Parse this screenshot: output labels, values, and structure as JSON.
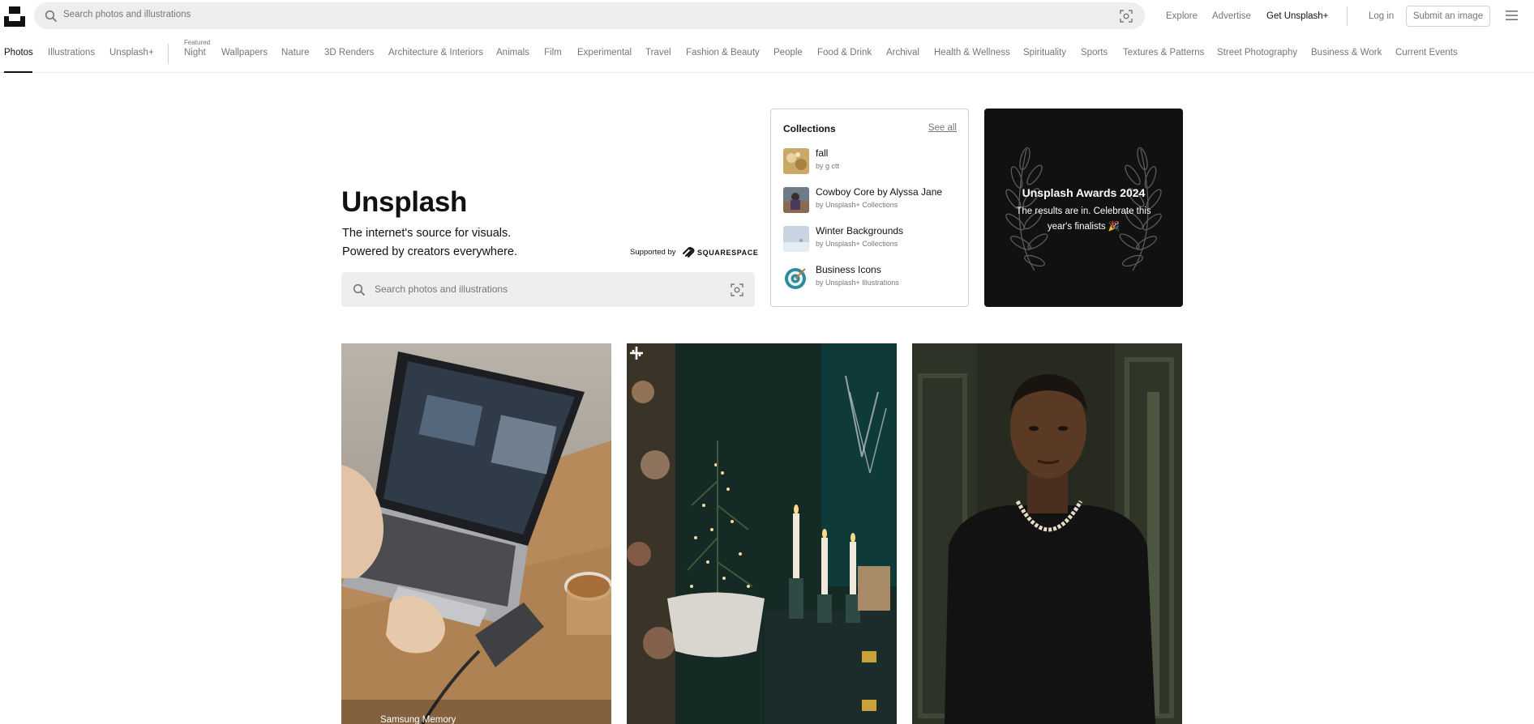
{
  "header": {
    "logo_icon": "unsplash-logo-icon",
    "search_placeholder": "Search photos and illustrations",
    "links": [
      "Explore",
      "Advertise",
      "Get Unsplash+"
    ],
    "login": "Log in",
    "submit": "Submit an image"
  },
  "nav": {
    "main": [
      "Photos",
      "Illustrations",
      "Unsplash+"
    ],
    "featured_label": "Featured",
    "topics": [
      "Night",
      "Wallpapers",
      "Nature",
      "3D Renders",
      "Architecture & Interiors",
      "Animals",
      "Film",
      "Experimental",
      "Travel",
      "Fashion & Beauty",
      "People",
      "Food & Drink",
      "Archival",
      "Health & Wellness",
      "Spirituality",
      "Sports",
      "Textures & Patterns",
      "Street Photography",
      "Business & Work",
      "Current Events"
    ]
  },
  "hero": {
    "title": "Unsplash",
    "line1": "The internet's source for visuals.",
    "line2": "Powered by creators everywhere.",
    "supported_by": "Supported by",
    "sponsor": "SQUARESPACE",
    "search_placeholder": "Search photos and illustrations"
  },
  "collections": {
    "heading": "Collections",
    "see_all": "See all",
    "items": [
      {
        "name": "fall",
        "by": "by g ctt"
      },
      {
        "name": "Cowboy Core by Alyssa Jane",
        "by": "by Unsplash+ Collections"
      },
      {
        "name": "Winter Backgrounds",
        "by": "by Unsplash+ Collections"
      },
      {
        "name": "Business Icons",
        "by": "by Unsplash+ Illustrations"
      }
    ]
  },
  "awards": {
    "title": "Unsplash Awards 2024",
    "text": "The results are in. Celebrate this year's finalists 🎉"
  },
  "photos": [
    {
      "caption": "Samsung Memory"
    },
    {
      "caption": ""
    },
    {
      "caption": ""
    }
  ],
  "colors": {
    "accent": "#111111",
    "muted": "#767676",
    "search_bg": "#eeeeee",
    "border": "#d1d1d1"
  }
}
